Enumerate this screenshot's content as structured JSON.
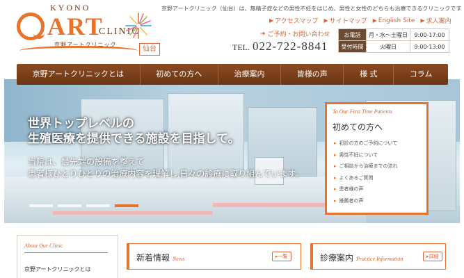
{
  "logo": {
    "top": "KYONO",
    "main": "ART",
    "sub": "CLINIC",
    "kana": "京野アートクリニック",
    "badge": "仙台"
  },
  "tagline": "京野アートクリニック（仙台）は、無精子症などの男性不妊をはじめ、男性と女性のどちらも治療できるクリニックです",
  "toplinks": [
    {
      "label": "アクセスマップ"
    },
    {
      "label": "サイトマップ"
    },
    {
      "label": "English Site"
    },
    {
      "label": "求人案内"
    }
  ],
  "reserve": "ご予約・お問い合わせ",
  "tel": {
    "label": "TEL.",
    "number": "022-722-8841"
  },
  "hours": {
    "phone_label": "お電話",
    "reception_label": "受付時間",
    "rows": [
      {
        "days": "月・水〜土曜日",
        "time": "9:00-17:00"
      },
      {
        "days": "火曜日",
        "time": "9:00-13:00"
      }
    ]
  },
  "nav": [
    "京野アートクリニックとは",
    "初めての方へ",
    "治療案内",
    "皆様の声",
    "様 式",
    "コラム"
  ],
  "hero": {
    "title_line1": "世界トップレベルの",
    "title_line2": "生殖医療を提供できる施設を目指して。",
    "sub_line1": "当院は、最先端の設備を整えて",
    "sub_line2": "患者様ひとりひとりの治療内容を理解し,日々の診療に取り組んでいます。",
    "slides": 4,
    "active_slide": 4
  },
  "first_time": {
    "en": "To Our First Time Patients",
    "ja": "初めての方へ",
    "items": [
      "初診の方のご予約について",
      "男性不妊について",
      "ご相談から治療までの流れ",
      "よくあるご質問",
      "患者様の声",
      "推薦者の声"
    ]
  },
  "about": {
    "en": "About Our Clinic",
    "ja": "京野アートクリニックとは"
  },
  "news": {
    "ja": "新着情報",
    "en": "News",
    "button": "一覧"
  },
  "medical": {
    "ja": "診療案内",
    "en": "Practice Information",
    "button": "詳細"
  },
  "colors": {
    "accent": "#e8732c",
    "nav": "#7a3f1a",
    "text": "#333333"
  }
}
